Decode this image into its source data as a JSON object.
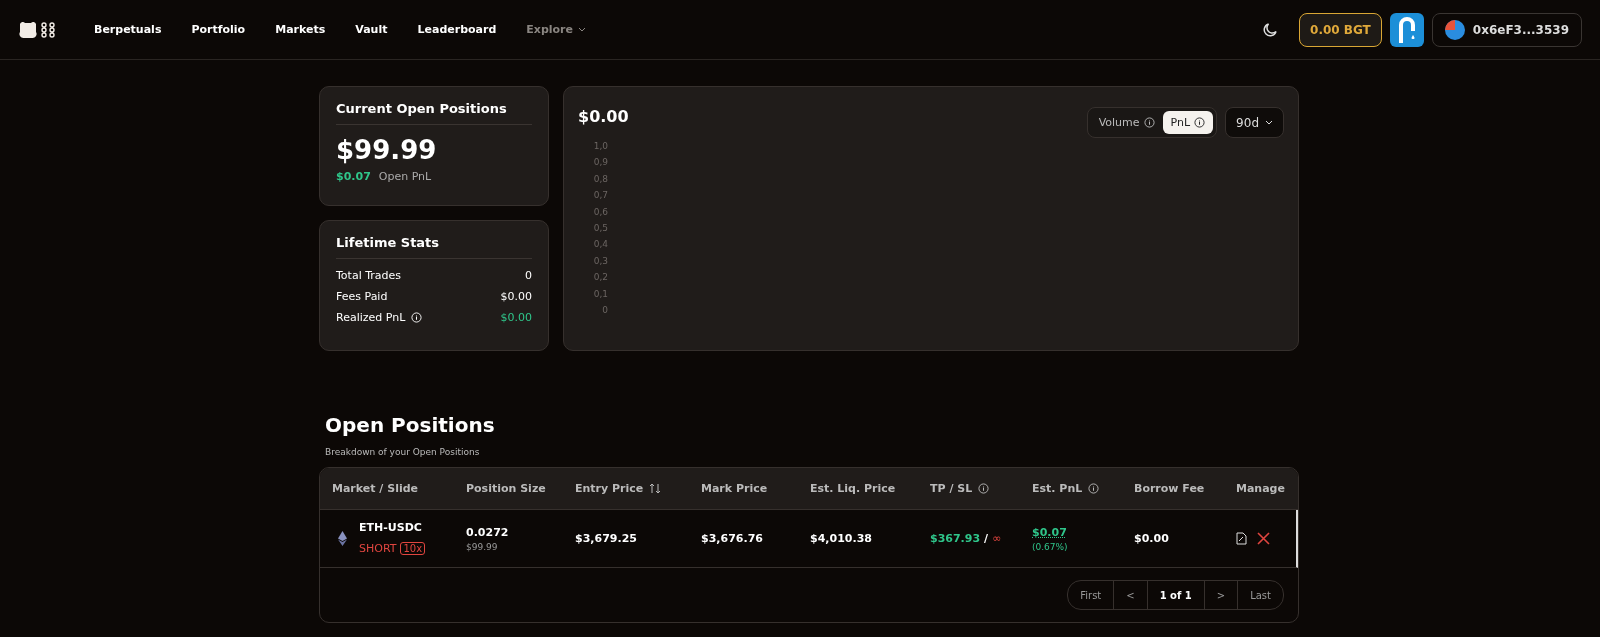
{
  "nav": {
    "items": [
      {
        "label": "Berpetuals",
        "kind": "link"
      },
      {
        "label": "Portfolio",
        "kind": "link"
      },
      {
        "label": "Markets",
        "kind": "link"
      },
      {
        "label": "Vault",
        "kind": "link"
      },
      {
        "label": "Leaderboard",
        "kind": "link"
      },
      {
        "label": "Explore",
        "kind": "dropdown"
      }
    ],
    "balance": "0.00 BGT",
    "wallet": "0x6eF3...3539"
  },
  "current_open_positions": {
    "title": "Current Open Positions",
    "value": "$99.99",
    "pnl": "$0.07",
    "pnl_label": "Open PnL"
  },
  "lifetime_stats": {
    "title": "Lifetime Stats",
    "rows": [
      {
        "label": "Total Trades",
        "value": "0",
        "kind": "plain"
      },
      {
        "label": "Fees Paid",
        "value": "$0.00",
        "kind": "plain"
      },
      {
        "label": "Realized PnL",
        "value": "$0.00",
        "kind": "info"
      }
    ]
  },
  "chart": {
    "value": "$0.00",
    "tabs": [
      {
        "label": "Volume",
        "selected": false
      },
      {
        "label": "PnL",
        "selected": true
      }
    ],
    "range": "90d",
    "y_axis_labels": [
      "1,0",
      "0,9",
      "0,8",
      "0,7",
      "0,6",
      "0,5",
      "0,4",
      "0,3",
      "0,2",
      "0,1",
      "0"
    ]
  },
  "open_positions": {
    "title": "Open Positions",
    "subtitle": "Breakdown of your Open Positions",
    "columns": [
      {
        "label": "Market / Slide",
        "kind": "plain"
      },
      {
        "label": "Position Size",
        "kind": "plain"
      },
      {
        "label": "Entry Price",
        "kind": "sort"
      },
      {
        "label": "Mark Price",
        "kind": "plain"
      },
      {
        "label": "Est. Liq. Price",
        "kind": "plain"
      },
      {
        "label": "TP / SL",
        "kind": "info"
      },
      {
        "label": "Est. PnL",
        "kind": "info"
      },
      {
        "label": "Borrow Fee",
        "kind": "plain"
      },
      {
        "label": "Manage",
        "kind": "plain"
      }
    ],
    "rows": [
      {
        "market": "ETH-USDC",
        "side": "SHORT",
        "leverage": "10x",
        "size": "0.0272",
        "size_usd": "$99.99",
        "entry_price": "$3,679.25",
        "mark_price": "$3,676.76",
        "liq_price": "$4,010.38",
        "tp": "$367.93",
        "separator": "/",
        "sl": "∞",
        "pnl": "$0.07",
        "pnl_pct": "(0.67%)",
        "borrow_fee": "$0.00"
      }
    ],
    "pagination": [
      "First",
      "<",
      "1 of 1",
      ">",
      "Last"
    ]
  }
}
